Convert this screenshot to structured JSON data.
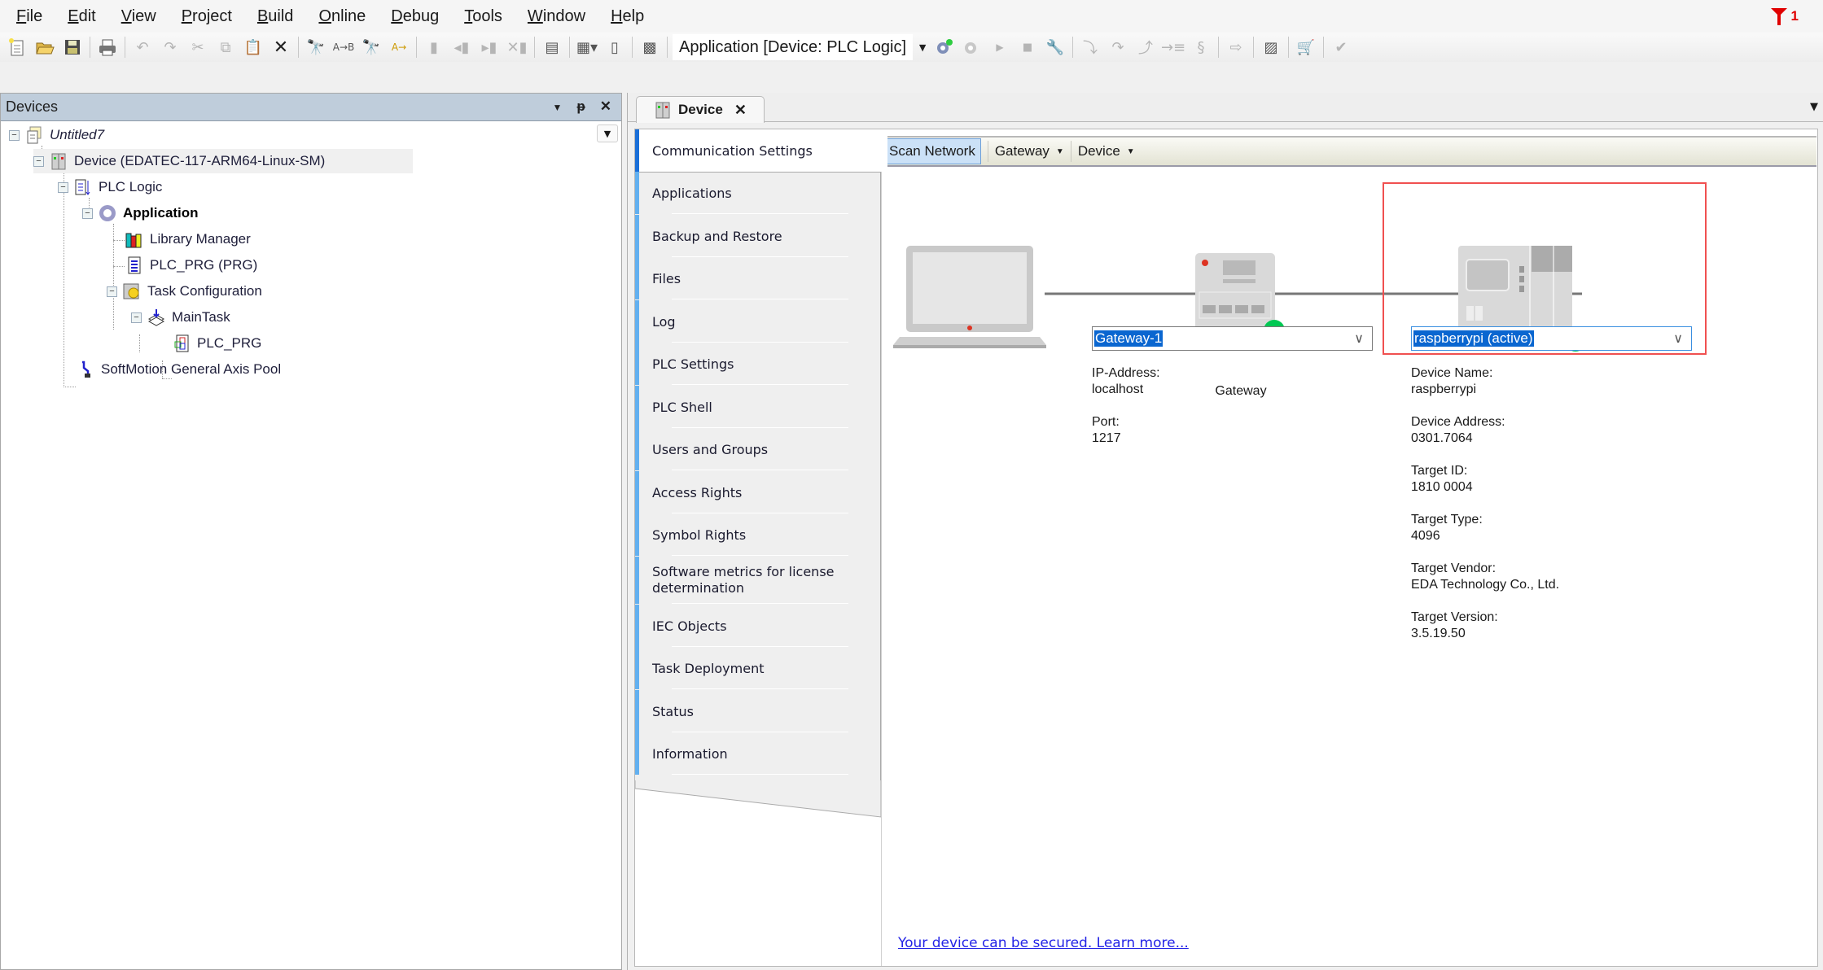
{
  "menu": [
    {
      "label": "File",
      "accel": "F",
      "rest": "ile"
    },
    {
      "label": "Edit",
      "accel": "E",
      "rest": "dit"
    },
    {
      "label": "View",
      "accel": "V",
      "rest": "iew"
    },
    {
      "label": "Project",
      "accel": "P",
      "rest": "roject"
    },
    {
      "label": "Build",
      "accel": "B",
      "rest": "uild"
    },
    {
      "label": "Online",
      "accel": "O",
      "rest": "nline"
    },
    {
      "label": "Debug",
      "accel": "D",
      "rest": "ebug"
    },
    {
      "label": "Tools",
      "accel": "T",
      "rest": "ools"
    },
    {
      "label": "Window",
      "accel": "W",
      "rest": "indow"
    },
    {
      "label": "Help",
      "accel": "H",
      "rest": "elp"
    }
  ],
  "filter_badge": {
    "count": "1",
    "color": "#e00000"
  },
  "toolbar": {
    "active_application": "Application [Device: PLC Logic]",
    "buttons": [
      "new-project",
      "open-project",
      "save-project",
      "print",
      "undo",
      "redo",
      "cut",
      "copy",
      "paste",
      "delete",
      "find",
      "replace",
      "find-in-project",
      "replace-in-project",
      "bookmark",
      "previous-bookmark",
      "next-bookmark",
      "clear-bookmarks",
      "clipboard",
      "add-object",
      "new-window",
      "visualization",
      "login",
      "logout",
      "start",
      "stop",
      "online-config",
      "step-into",
      "step-over",
      "step-out",
      "run-to-cursor",
      "set-next",
      "show-next",
      "toggle-breakpoint",
      "shopping-cart",
      "check"
    ]
  },
  "devices_panel": {
    "title": "Devices",
    "tree": [
      {
        "label": "Untitled7",
        "level": 0,
        "icon": "project-icon",
        "italic": true,
        "expanded": true
      },
      {
        "label": "Device (EDATEC-117-ARM64-Linux-SM)",
        "level": 1,
        "icon": "device-icon",
        "selected": true,
        "expanded": true
      },
      {
        "label": "PLC Logic",
        "level": 2,
        "icon": "plc-logic-icon",
        "expanded": true
      },
      {
        "label": "Application",
        "level": 3,
        "icon": "application-gear-icon",
        "bold": true,
        "expanded": true
      },
      {
        "label": "Library Manager",
        "level": 4,
        "icon": "library-icon"
      },
      {
        "label": "PLC_PRG (PRG)",
        "level": 4,
        "icon": "program-icon"
      },
      {
        "label": "Task Configuration",
        "level": 4,
        "icon": "task-config-icon",
        "expanded": true
      },
      {
        "label": "MainTask",
        "level": 5,
        "icon": "task-icon",
        "expanded": true
      },
      {
        "label": "PLC_PRG",
        "level": 6,
        "icon": "program-call-icon"
      },
      {
        "label": "SoftMotion General Axis Pool",
        "level": 2,
        "icon": "axis-pool-icon"
      }
    ]
  },
  "editor": {
    "tab_label": "Device",
    "nav": [
      "Communication Settings",
      "Applications",
      "Backup and Restore",
      "Files",
      "Log",
      "PLC Settings",
      "PLC Shell",
      "Users and Groups",
      "Access Rights",
      "Symbol Rights",
      "Software metrics for license determination",
      "IEC Objects",
      "Task Deployment",
      "Status",
      "Information"
    ],
    "active_nav": 0,
    "content_toolbar": {
      "scan": "Scan Network",
      "gateway": "Gateway",
      "device": "Device"
    },
    "gateway": {
      "caption": "Gateway",
      "selected": "Gateway-1",
      "status_color": "#00c853",
      "fields": [
        {
          "label": "IP-Address:",
          "value": "localhost"
        },
        {
          "label": "Port:",
          "value": "1217"
        }
      ]
    },
    "device": {
      "selected": "raspberrypi (active)",
      "status_color": "#00c853",
      "highlight_color": "#f05050",
      "fields": [
        {
          "label": "Device Name:",
          "value": "raspberrypi"
        },
        {
          "label": "Device Address:",
          "value": "0301.7064"
        },
        {
          "label": "Target ID:",
          "value": "1810  0004"
        },
        {
          "label": "Target Type:",
          "value": "4096"
        },
        {
          "label": "Target Vendor:",
          "value": "EDA Technology Co., Ltd."
        },
        {
          "label": "Target Version:",
          "value": "3.5.19.50"
        }
      ]
    },
    "security_link": "Your device can be secured. Learn more..."
  }
}
